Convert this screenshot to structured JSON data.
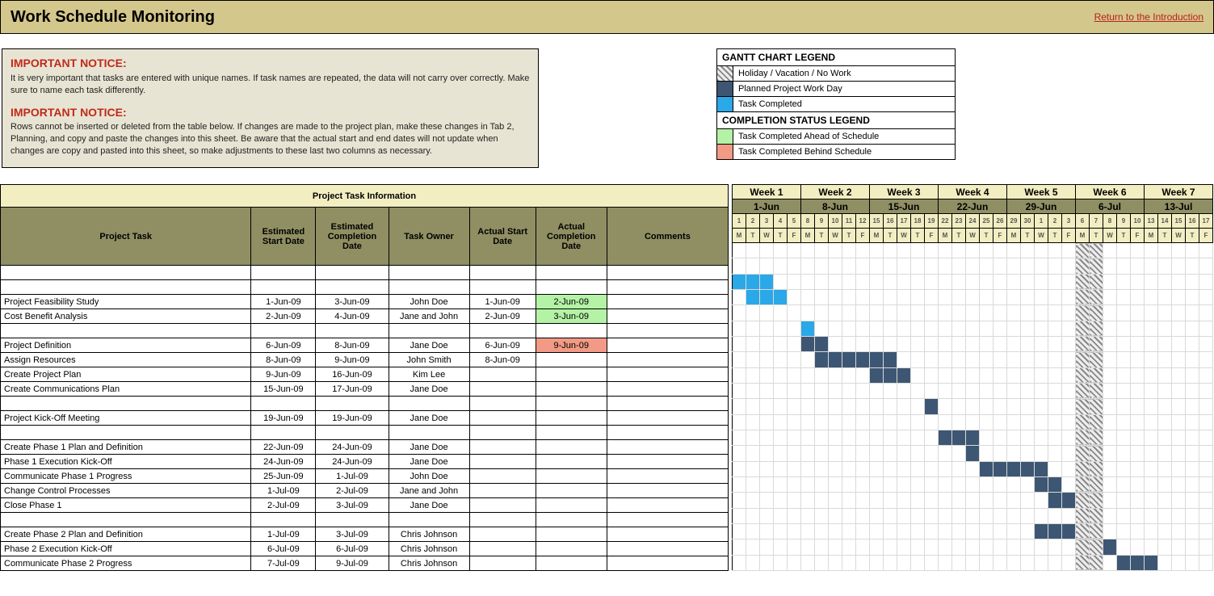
{
  "header": {
    "title": "Work Schedule Monitoring",
    "return_link": "Return to the Introduction"
  },
  "notice": {
    "title1": "IMPORTANT NOTICE:",
    "text1": "It is very important that tasks are entered with unique names. If task names are repeated, the data will not carry over correctly. Make sure to name each task differently.",
    "title2": "IMPORTANT NOTICE:",
    "text2": "Rows cannot be inserted or deleted from the table below. If changes are made to the project plan, make these changes in Tab 2, Planning, and copy and paste the changes into this sheet. Be aware that the actual start and end dates will not update when changes are copy and pasted into this sheet, so make adjustments to these last two columns as necessary."
  },
  "legend": {
    "gantt_title": "GANTT CHART LEGEND",
    "holiday": "Holiday / Vacation / No Work",
    "planned": "Planned Project Work Day",
    "completed": "Task Completed",
    "status_title": "COMPLETION STATUS LEGEND",
    "ahead": "Task Completed Ahead of Schedule",
    "behind": "Task Completed Behind Schedule"
  },
  "table_headers": {
    "section": "Project Task Information",
    "task": "Project Task",
    "est_start": "Estimated Start Date",
    "est_comp": "Estimated Completion Date",
    "owner": "Task Owner",
    "act_start": "Actual Start Date",
    "act_comp": "Actual Completion Date",
    "comments": "Comments"
  },
  "chart_data": {
    "type": "gantt",
    "weeks": [
      {
        "label": "Week 1",
        "start": "1-Jun",
        "days": [
          1,
          2,
          3,
          4,
          5
        ],
        "wd": [
          "M",
          "T",
          "W",
          "T",
          "F"
        ]
      },
      {
        "label": "Week 2",
        "start": "8-Jun",
        "days": [
          8,
          9,
          10,
          11,
          12
        ],
        "wd": [
          "M",
          "T",
          "W",
          "T",
          "F"
        ]
      },
      {
        "label": "Week 3",
        "start": "15-Jun",
        "days": [
          15,
          16,
          17,
          18,
          19
        ],
        "wd": [
          "M",
          "T",
          "W",
          "T",
          "F"
        ]
      },
      {
        "label": "Week 4",
        "start": "22-Jun",
        "days": [
          22,
          23,
          24,
          25,
          26
        ],
        "wd": [
          "M",
          "T",
          "W",
          "T",
          "F"
        ]
      },
      {
        "label": "Week 5",
        "start": "29-Jun",
        "days": [
          29,
          30,
          1,
          2,
          3
        ],
        "wd": [
          "M",
          "T",
          "W",
          "T",
          "F"
        ]
      },
      {
        "label": "Week 6",
        "start": "6-Jul",
        "days": [
          6,
          7,
          8,
          9,
          10
        ],
        "wd": [
          "M",
          "T",
          "W",
          "T",
          "F"
        ]
      },
      {
        "label": "Week 7",
        "start": "13-Jul",
        "days": [
          13,
          14,
          15,
          16,
          17
        ],
        "wd": [
          "M",
          "T",
          "W",
          "T",
          "F"
        ]
      }
    ],
    "holiday_columns": [
      25,
      26
    ],
    "tasks": [
      {
        "name": "",
        "est_start": "",
        "est_comp": "",
        "owner": "",
        "act_start": "",
        "act_comp": "",
        "status": "",
        "bars": []
      },
      {
        "name": "",
        "est_start": "",
        "est_comp": "",
        "owner": "",
        "act_start": "",
        "act_comp": "",
        "status": "",
        "bars": []
      },
      {
        "name": "Project Feasibility Study",
        "est_start": "1-Jun-09",
        "est_comp": "3-Jun-09",
        "owner": "John Doe",
        "act_start": "1-Jun-09",
        "act_comp": "2-Jun-09",
        "status": "ahead",
        "bars": [
          {
            "col": 0,
            "type": "done"
          },
          {
            "col": 1,
            "type": "done"
          },
          {
            "col": 2,
            "type": "done"
          }
        ]
      },
      {
        "name": "Cost Benefit Analysis",
        "est_start": "2-Jun-09",
        "est_comp": "4-Jun-09",
        "owner": "Jane and John",
        "act_start": "2-Jun-09",
        "act_comp": "3-Jun-09",
        "status": "ahead",
        "bars": [
          {
            "col": 1,
            "type": "done"
          },
          {
            "col": 2,
            "type": "done"
          },
          {
            "col": 3,
            "type": "done"
          }
        ]
      },
      {
        "name": "",
        "est_start": "",
        "est_comp": "",
        "owner": "",
        "act_start": "",
        "act_comp": "",
        "status": "",
        "bars": []
      },
      {
        "name": "Project Definition",
        "est_start": "6-Jun-09",
        "est_comp": "8-Jun-09",
        "owner": "Jane Doe",
        "act_start": "6-Jun-09",
        "act_comp": "9-Jun-09",
        "status": "behind",
        "bars": [
          {
            "col": 5,
            "type": "done"
          }
        ]
      },
      {
        "name": "Assign Resources",
        "est_start": "8-Jun-09",
        "est_comp": "9-Jun-09",
        "owner": "John Smith",
        "act_start": "8-Jun-09",
        "act_comp": "",
        "status": "",
        "bars": [
          {
            "col": 5,
            "type": "planned"
          },
          {
            "col": 6,
            "type": "planned"
          }
        ]
      },
      {
        "name": "Create Project Plan",
        "est_start": "9-Jun-09",
        "est_comp": "16-Jun-09",
        "owner": "Kim Lee",
        "act_start": "",
        "act_comp": "",
        "status": "",
        "bars": [
          {
            "col": 6,
            "type": "planned"
          },
          {
            "col": 7,
            "type": "planned"
          },
          {
            "col": 8,
            "type": "planned"
          },
          {
            "col": 9,
            "type": "planned"
          },
          {
            "col": 10,
            "type": "planned"
          },
          {
            "col": 11,
            "type": "planned"
          }
        ]
      },
      {
        "name": "Create Communications Plan",
        "est_start": "15-Jun-09",
        "est_comp": "17-Jun-09",
        "owner": "Jane Doe",
        "act_start": "",
        "act_comp": "",
        "status": "",
        "bars": [
          {
            "col": 10,
            "type": "planned"
          },
          {
            "col": 11,
            "type": "planned"
          },
          {
            "col": 12,
            "type": "planned"
          }
        ]
      },
      {
        "name": "",
        "est_start": "",
        "est_comp": "",
        "owner": "",
        "act_start": "",
        "act_comp": "",
        "status": "",
        "bars": []
      },
      {
        "name": "Project Kick-Off Meeting",
        "est_start": "19-Jun-09",
        "est_comp": "19-Jun-09",
        "owner": "Jane Doe",
        "act_start": "",
        "act_comp": "",
        "status": "",
        "bars": [
          {
            "col": 14,
            "type": "planned"
          }
        ]
      },
      {
        "name": "",
        "est_start": "",
        "est_comp": "",
        "owner": "",
        "act_start": "",
        "act_comp": "",
        "status": "",
        "bars": []
      },
      {
        "name": "Create Phase 1 Plan and Definition",
        "est_start": "22-Jun-09",
        "est_comp": "24-Jun-09",
        "owner": "Jane Doe",
        "act_start": "",
        "act_comp": "",
        "status": "",
        "bars": [
          {
            "col": 15,
            "type": "planned"
          },
          {
            "col": 16,
            "type": "planned"
          },
          {
            "col": 17,
            "type": "planned"
          }
        ]
      },
      {
        "name": "Phase 1 Execution Kick-Off",
        "est_start": "24-Jun-09",
        "est_comp": "24-Jun-09",
        "owner": "Jane Doe",
        "act_start": "",
        "act_comp": "",
        "status": "",
        "bars": [
          {
            "col": 17,
            "type": "planned"
          }
        ]
      },
      {
        "name": "Communicate Phase 1 Progress",
        "est_start": "25-Jun-09",
        "est_comp": "1-Jul-09",
        "owner": "John Doe",
        "act_start": "",
        "act_comp": "",
        "status": "",
        "bars": [
          {
            "col": 18,
            "type": "planned"
          },
          {
            "col": 19,
            "type": "planned"
          },
          {
            "col": 20,
            "type": "planned"
          },
          {
            "col": 21,
            "type": "planned"
          },
          {
            "col": 22,
            "type": "planned"
          }
        ]
      },
      {
        "name": "Change Control Processes",
        "est_start": "1-Jul-09",
        "est_comp": "2-Jul-09",
        "owner": "Jane and John",
        "act_start": "",
        "act_comp": "",
        "status": "",
        "bars": [
          {
            "col": 22,
            "type": "planned"
          },
          {
            "col": 23,
            "type": "planned"
          }
        ]
      },
      {
        "name": "Close Phase 1",
        "est_start": "2-Jul-09",
        "est_comp": "3-Jul-09",
        "owner": "Jane Doe",
        "act_start": "",
        "act_comp": "",
        "status": "",
        "bars": [
          {
            "col": 23,
            "type": "planned"
          },
          {
            "col": 24,
            "type": "planned"
          }
        ]
      },
      {
        "name": "",
        "est_start": "",
        "est_comp": "",
        "owner": "",
        "act_start": "",
        "act_comp": "",
        "status": "",
        "bars": []
      },
      {
        "name": "Create Phase 2 Plan and Definition",
        "est_start": "1-Jul-09",
        "est_comp": "3-Jul-09",
        "owner": "Chris Johnson",
        "act_start": "",
        "act_comp": "",
        "status": "",
        "bars": [
          {
            "col": 22,
            "type": "planned"
          },
          {
            "col": 23,
            "type": "planned"
          },
          {
            "col": 24,
            "type": "planned"
          }
        ]
      },
      {
        "name": "Phase 2 Execution Kick-Off",
        "est_start": "6-Jul-09",
        "est_comp": "6-Jul-09",
        "owner": "Chris Johnson",
        "act_start": "",
        "act_comp": "",
        "status": "",
        "bars": [
          {
            "col": 27,
            "type": "planned"
          }
        ]
      },
      {
        "name": "Communicate Phase 2 Progress",
        "est_start": "7-Jul-09",
        "est_comp": "9-Jul-09",
        "owner": "Chris Johnson",
        "act_start": "",
        "act_comp": "",
        "status": "",
        "bars": [
          {
            "col": 28,
            "type": "planned"
          },
          {
            "col": 29,
            "type": "planned"
          },
          {
            "col": 30,
            "type": "planned"
          }
        ]
      }
    ]
  }
}
